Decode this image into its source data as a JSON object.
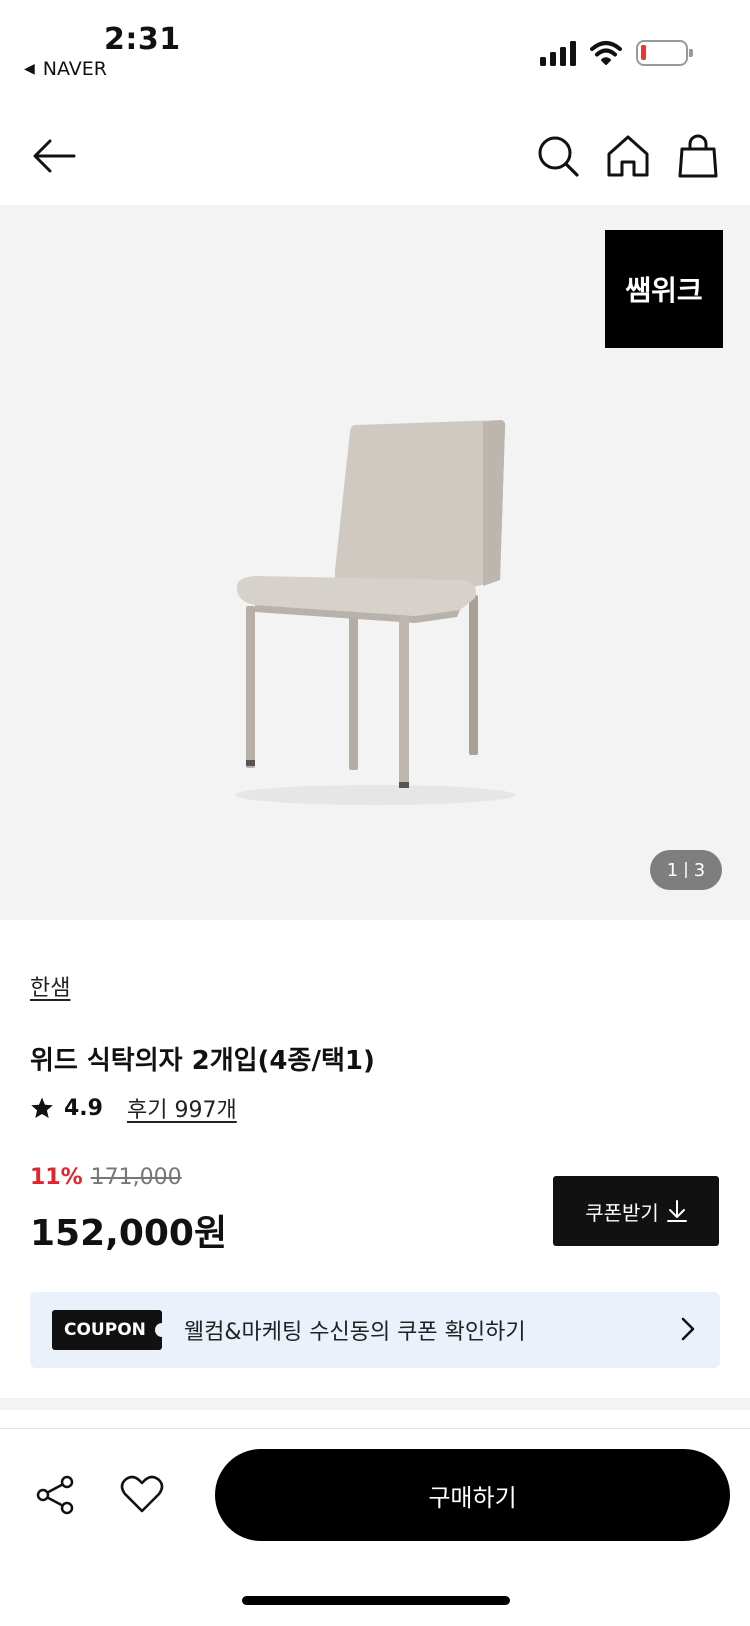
{
  "status_bar": {
    "time": "2:31",
    "back_app": "NAVER",
    "back_arrow": "◀"
  },
  "header": {
    "icons": [
      "back-arrow-icon",
      "search-icon",
      "home-icon",
      "shopping-bag-icon"
    ]
  },
  "gallery": {
    "badge": "쌤위크",
    "current": "1",
    "total": "3",
    "image": "gray-dining-chair"
  },
  "product": {
    "brand": "한샘",
    "title": "위드 식탁의자 2개입(4종/택1)",
    "rating": "4.9",
    "reviews": "후기 997개",
    "discount": "11%",
    "original_price": "171,000",
    "price": "152,000원"
  },
  "coupon": {
    "button_label": "쿠폰받기",
    "tag": "COUPON",
    "banner_text": "웰컴&마케팅 수신동의 쿠폰 확인하기"
  },
  "bottom_bar": {
    "buy_label": "구매하기"
  },
  "colors": {
    "accent_discount": "#e3242b",
    "banner_bg": "#eaf1fb",
    "button_dark": "#111111"
  }
}
